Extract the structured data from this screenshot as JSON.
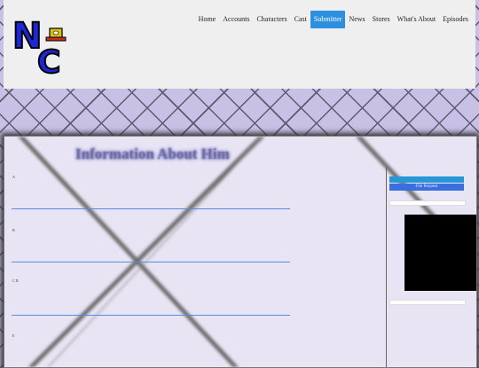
{
  "header": {
    "logo_text": "NC",
    "nav": [
      "Home",
      "Accounts",
      "Characters",
      "Cast",
      "Submitter",
      "News",
      "Stores",
      "What's About",
      "Episodes"
    ],
    "active_index": 4
  },
  "main": {
    "title": "Information About Him",
    "sections": [
      {
        "label": "A"
      },
      {
        "label": "B"
      },
      {
        "label": "C D"
      },
      {
        "label": "E"
      }
    ]
  },
  "sidebar": {
    "button_label": "File Request"
  },
  "colors": {
    "accent": "#2e8fe0",
    "pattern_bg": "#c9c0e6",
    "content_bg": "#e8e4f4",
    "title": "#6f6da3",
    "divider": "#5b8be0"
  },
  "icons": [
    "logo-icon",
    "video-player"
  ]
}
